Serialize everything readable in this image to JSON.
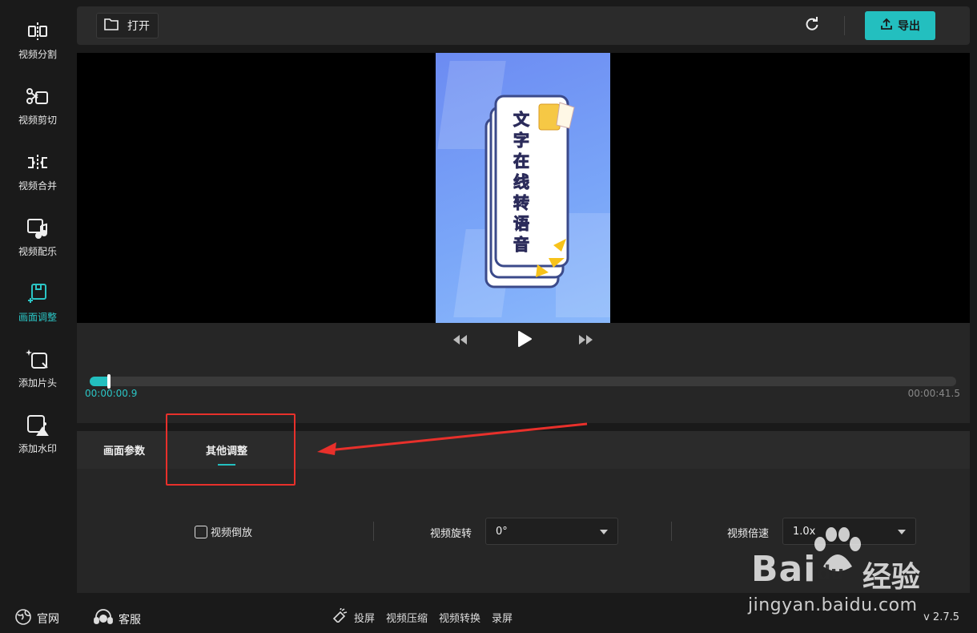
{
  "sidebar": {
    "items": [
      {
        "label": "视频分割",
        "icon": "split-icon",
        "active": false
      },
      {
        "label": "视频剪切",
        "icon": "scissors-icon",
        "active": false
      },
      {
        "label": "视频合并",
        "icon": "merge-icon",
        "active": false
      },
      {
        "label": "视频配乐",
        "icon": "music-icon",
        "active": false
      },
      {
        "label": "画面调整",
        "icon": "crop-icon",
        "active": true
      },
      {
        "label": "添加片头",
        "icon": "intro-icon",
        "active": false
      },
      {
        "label": "添加水印",
        "icon": "watermark-icon",
        "active": false
      }
    ]
  },
  "toolbar": {
    "open_label": "打开",
    "export_label": "导出"
  },
  "preview": {
    "thumbnail_text": "文字在线转语音"
  },
  "player": {
    "current_time": "00:00:00.9",
    "total_time": "00:00:41.5",
    "progress_fraction": 0.022
  },
  "panel": {
    "tabs": [
      {
        "label": "画面参数",
        "active": false
      },
      {
        "label": "其他调整",
        "active": true
      }
    ],
    "reverse_label": "视频倒放",
    "reverse_checked": false,
    "rotate_label": "视频旋转",
    "rotate_value": "0°",
    "speed_label": "视频倍速",
    "speed_value": "1.0x"
  },
  "footer": {
    "website_label": "官网",
    "support_label": "客服",
    "tools": [
      "投屏",
      "视频压缩",
      "视频转换",
      "录屏"
    ],
    "version": "v 2.7.5"
  },
  "watermark": {
    "brand_latin": "Bai",
    "brand_du": "du",
    "brand_cn": "经验",
    "url": "jingyan.baidu.com"
  },
  "colors": {
    "accent": "#23bfbf",
    "annotation": "#e8302b"
  }
}
